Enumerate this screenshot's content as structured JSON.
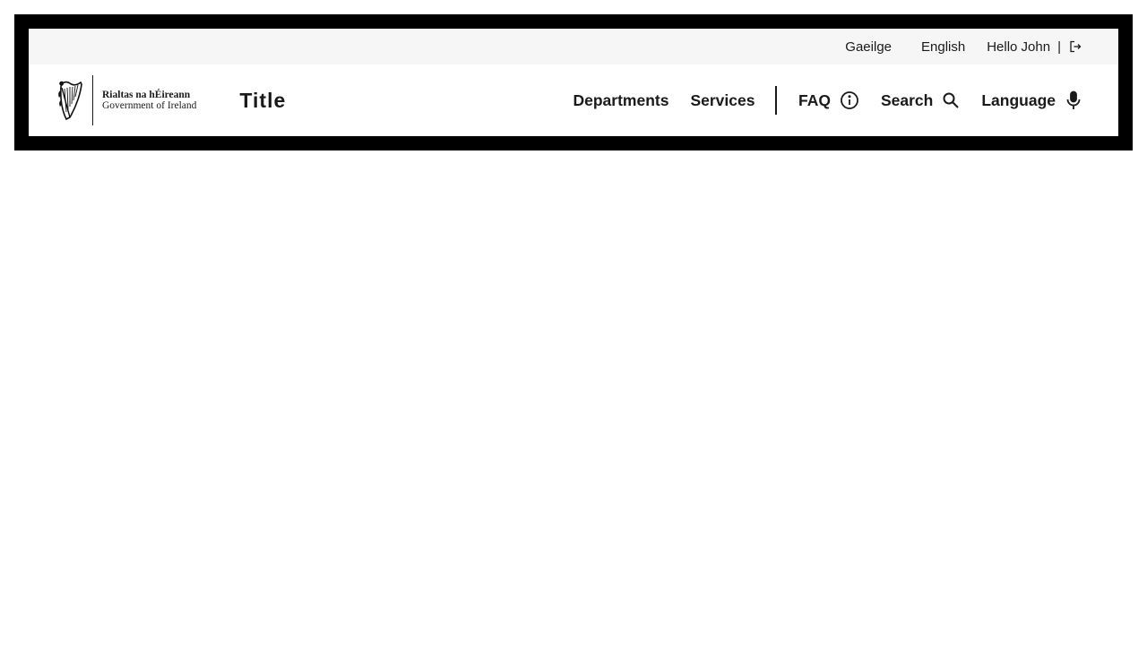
{
  "topbar": {
    "lang_ga": "Gaeilge",
    "lang_en": "English",
    "greeting": "Hello John",
    "separator": "|",
    "logout_icon": "logout-icon"
  },
  "logo": {
    "line1": "Rialtas na hÉireann",
    "line2": "Government of Ireland",
    "icon": "harp-icon"
  },
  "header": {
    "title": "Title"
  },
  "nav": {
    "departments": "Departments",
    "services": "Services",
    "faq": "FAQ",
    "faq_icon": "info-icon",
    "search": "Search",
    "search_icon": "search-icon",
    "language": "Language",
    "language_icon": "microphone-icon"
  },
  "colors": {
    "frame": "#000000",
    "topbar_bg": "#f6f6f6",
    "text": "#1a1a1a"
  }
}
